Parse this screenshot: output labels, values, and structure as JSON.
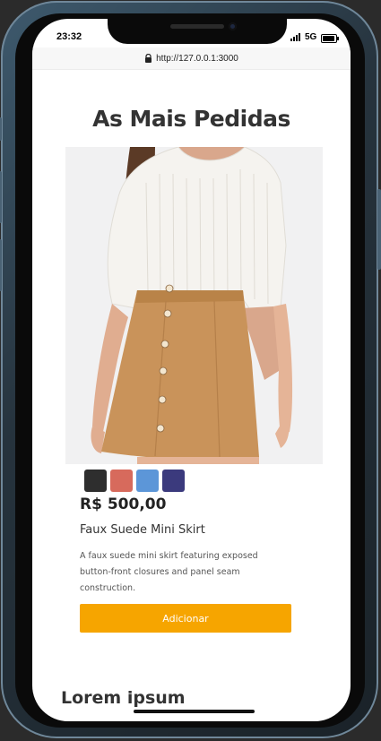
{
  "status_bar": {
    "time": "23:32",
    "network": "5G"
  },
  "browser": {
    "url": "http://127.0.0.1:3000",
    "lock_icon": "lock-icon"
  },
  "section": {
    "heading": "As Mais Pedidas"
  },
  "product": {
    "image_icon": "product-photo",
    "colors": [
      "#2e2e2e",
      "#d76a5c",
      "#5c96d8",
      "#3b3a7d"
    ],
    "price": "R$ 500,00",
    "name": "Faux Suede Mini Skirt",
    "description": "A faux suede mini skirt featuring exposed button-front closures and panel seam construction.",
    "button_label": "Adicionar",
    "button_color": "#f6a500"
  },
  "next_section": {
    "title": "Lorem ipsum"
  }
}
